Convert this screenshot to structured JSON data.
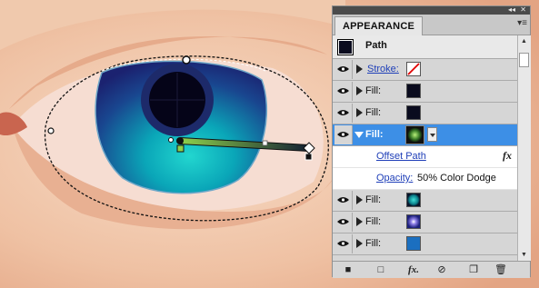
{
  "panel": {
    "tab_label": "APPEARANCE",
    "collapse_glyph": "◂◂",
    "close_glyph": "✕",
    "menu_glyph": "▾≡",
    "object_title": "Path",
    "rows": [
      {
        "label": "Stroke:",
        "style": "link",
        "swatch": "none-swatch"
      },
      {
        "label": "Fill:",
        "swatch_color": "#0a0b1e"
      },
      {
        "label": "Fill:",
        "swatch_color": "#0a0b1e"
      },
      {
        "label": "Fill:",
        "selected": true,
        "swatch": "radial-green"
      },
      {
        "sub_label": "Offset Path",
        "fx": "fx"
      },
      {
        "sub_label": "Opacity:",
        "sub_value": "50% Color Dodge"
      },
      {
        "label": "Fill:",
        "swatch": "radial-teal"
      },
      {
        "label": "Fill:",
        "swatch": "radial-violet"
      },
      {
        "label": "Fill:",
        "swatch_color": "#1b6fc0"
      }
    ],
    "footer": {
      "new_stroke": "■",
      "new_fill": "□",
      "add_effect": "fx.",
      "clear": "⊘",
      "duplicate": "❐",
      "delete": "🗑"
    }
  },
  "colors": {
    "skin": "#f2c7ab",
    "iris_dark": "#1e2d8a",
    "iris_teal": "#0aa6b8",
    "pupil": "#050418",
    "selection_blue": "#3d8fe6"
  }
}
